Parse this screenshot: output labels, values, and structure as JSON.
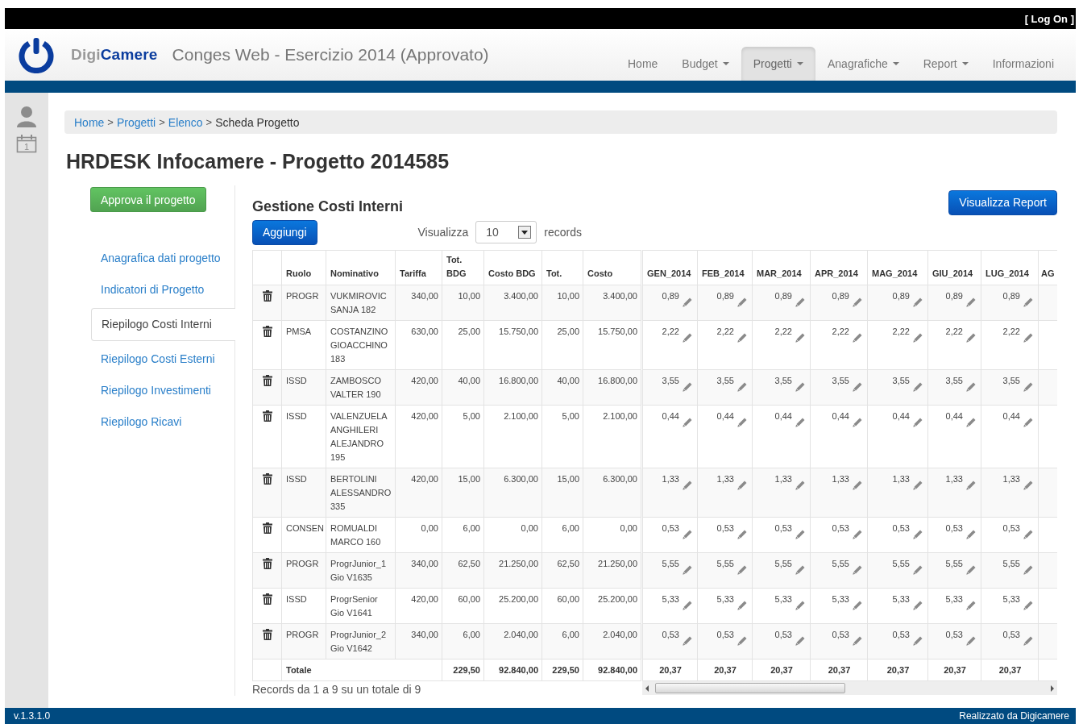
{
  "top_bar": {
    "login": "[ Log On ]"
  },
  "header": {
    "brand_light": "Digi",
    "brand_strong": "Camere",
    "app_title": "Conges Web - Esercizio 2014 (Approvato)",
    "nav": [
      {
        "label": "Home",
        "dropdown": false,
        "selected": false
      },
      {
        "label": "Budget",
        "dropdown": true,
        "selected": false
      },
      {
        "label": "Progetti",
        "dropdown": true,
        "selected": true
      },
      {
        "label": "Anagrafiche",
        "dropdown": true,
        "selected": false
      },
      {
        "label": "Report",
        "dropdown": true,
        "selected": false
      },
      {
        "label": "Informazioni",
        "dropdown": false,
        "selected": false
      }
    ]
  },
  "rail": {
    "calendar_day": "1"
  },
  "breadcrumb": [
    {
      "label": "Home",
      "kind": "link"
    },
    {
      "label": ">",
      "kind": "separator"
    },
    {
      "label": "Progetti",
      "kind": "link"
    },
    {
      "label": ">",
      "kind": "separator"
    },
    {
      "label": "Elenco",
      "kind": "link"
    },
    {
      "label": ">",
      "kind": "separator"
    },
    {
      "label": "Scheda Progetto",
      "kind": "current"
    }
  ],
  "page_title": "HRDESK Infocamere - Progetto 2014585",
  "approve_button": "Approva il progetto",
  "side_nav": [
    {
      "label": "Anagrafica dati progetto",
      "selected": false
    },
    {
      "label": "Indicatori di Progetto",
      "selected": false
    },
    {
      "label": "Riepilogo Costi Interni",
      "selected": true
    },
    {
      "label": "Riepilogo Costi Esterni",
      "selected": false
    },
    {
      "label": "Riepilogo Investimenti",
      "selected": false
    },
    {
      "label": "Riepilogo Ricavi",
      "selected": false
    }
  ],
  "section": {
    "title": "Gestione Costi Interni",
    "report_button": "Visualizza Report",
    "add_button": "Aggiungi",
    "show_label": "Visualizza",
    "page_size": "10",
    "records_label": "records"
  },
  "table": {
    "columns": [
      "Ruolo",
      "Nominativo",
      "Tariffa",
      "Tot. BDG",
      "Costo BDG",
      "Tot.",
      "Costo"
    ],
    "month_columns": [
      "GEN_2014",
      "FEB_2014",
      "MAR_2014",
      "APR_2014",
      "MAG_2014",
      "GIU_2014",
      "LUG_2014",
      "AG"
    ],
    "rows": [
      {
        "ruolo": "PROGR",
        "nominativo": "VUKMIROVIC SANJA 182",
        "tariffa": "340,00",
        "tot_bdg": "10,00",
        "costo_bdg": "3.400,00",
        "tot": "10,00",
        "costo": "3.400,00",
        "months": [
          "0,89",
          "0,89",
          "0,89",
          "0,89",
          "0,89",
          "0,89",
          "0,89"
        ]
      },
      {
        "ruolo": "PMSA",
        "nominativo": "COSTANZINO GIOACCHINO 183",
        "tariffa": "630,00",
        "tot_bdg": "25,00",
        "costo_bdg": "15.750,00",
        "tot": "25,00",
        "costo": "15.750,00",
        "months": [
          "2,22",
          "2,22",
          "2,22",
          "2,22",
          "2,22",
          "2,22",
          "2,22"
        ]
      },
      {
        "ruolo": "ISSD",
        "nominativo": "ZAMBOSCO VALTER 190",
        "tariffa": "420,00",
        "tot_bdg": "40,00",
        "costo_bdg": "16.800,00",
        "tot": "40,00",
        "costo": "16.800,00",
        "months": [
          "3,55",
          "3,55",
          "3,55",
          "3,55",
          "3,55",
          "3,55",
          "3,55"
        ]
      },
      {
        "ruolo": "ISSD",
        "nominativo": "VALENZUELA ANGHILERI ALEJANDRO 195",
        "tariffa": "420,00",
        "tot_bdg": "5,00",
        "costo_bdg": "2.100,00",
        "tot": "5,00",
        "costo": "2.100,00",
        "months": [
          "0,44",
          "0,44",
          "0,44",
          "0,44",
          "0,44",
          "0,44",
          "0,44"
        ]
      },
      {
        "ruolo": "ISSD",
        "nominativo": "BERTOLINI ALESSANDRO 335",
        "tariffa": "420,00",
        "tot_bdg": "15,00",
        "costo_bdg": "6.300,00",
        "tot": "15,00",
        "costo": "6.300,00",
        "months": [
          "1,33",
          "1,33",
          "1,33",
          "1,33",
          "1,33",
          "1,33",
          "1,33"
        ]
      },
      {
        "ruolo": "CONSEN",
        "nominativo": "ROMUALDI MARCO 160",
        "tariffa": "0,00",
        "tot_bdg": "6,00",
        "costo_bdg": "0,00",
        "tot": "6,00",
        "costo": "0,00",
        "months": [
          "0,53",
          "0,53",
          "0,53",
          "0,53",
          "0,53",
          "0,53",
          "0,53"
        ]
      },
      {
        "ruolo": "PROGR",
        "nominativo": "ProgrJunior_1 Gio V1635",
        "tariffa": "340,00",
        "tot_bdg": "62,50",
        "costo_bdg": "21.250,00",
        "tot": "62,50",
        "costo": "21.250,00",
        "months": [
          "5,55",
          "5,55",
          "5,55",
          "5,55",
          "5,55",
          "5,55",
          "5,55"
        ]
      },
      {
        "ruolo": "ISSD",
        "nominativo": "ProgrSenior Gio V1641",
        "tariffa": "420,00",
        "tot_bdg": "60,00",
        "costo_bdg": "25.200,00",
        "tot": "60,00",
        "costo": "25.200,00",
        "months": [
          "5,33",
          "5,33",
          "5,33",
          "5,33",
          "5,33",
          "5,33",
          "5,33"
        ]
      },
      {
        "ruolo": "PROGR",
        "nominativo": "ProgrJunior_2 Gio V1642",
        "tariffa": "340,00",
        "tot_bdg": "6,00",
        "costo_bdg": "2.040,00",
        "tot": "6,00",
        "costo": "2.040,00",
        "months": [
          "0,53",
          "0,53",
          "0,53",
          "0,53",
          "0,53",
          "0,53",
          "0,53"
        ]
      }
    ],
    "total": {
      "label": "Totale",
      "tot_bdg": "229,50",
      "costo_bdg": "92.840,00",
      "tot": "229,50",
      "costo": "92.840,00",
      "months": [
        "20,37",
        "20,37",
        "20,37",
        "20,37",
        "20,37",
        "20,37",
        "20,37"
      ]
    }
  },
  "records_info": "Records da 1 a 9 su un totale di 9",
  "footer": {
    "version": "v.1.3.1.0",
    "credit": "Realizzato da Digicamere"
  }
}
